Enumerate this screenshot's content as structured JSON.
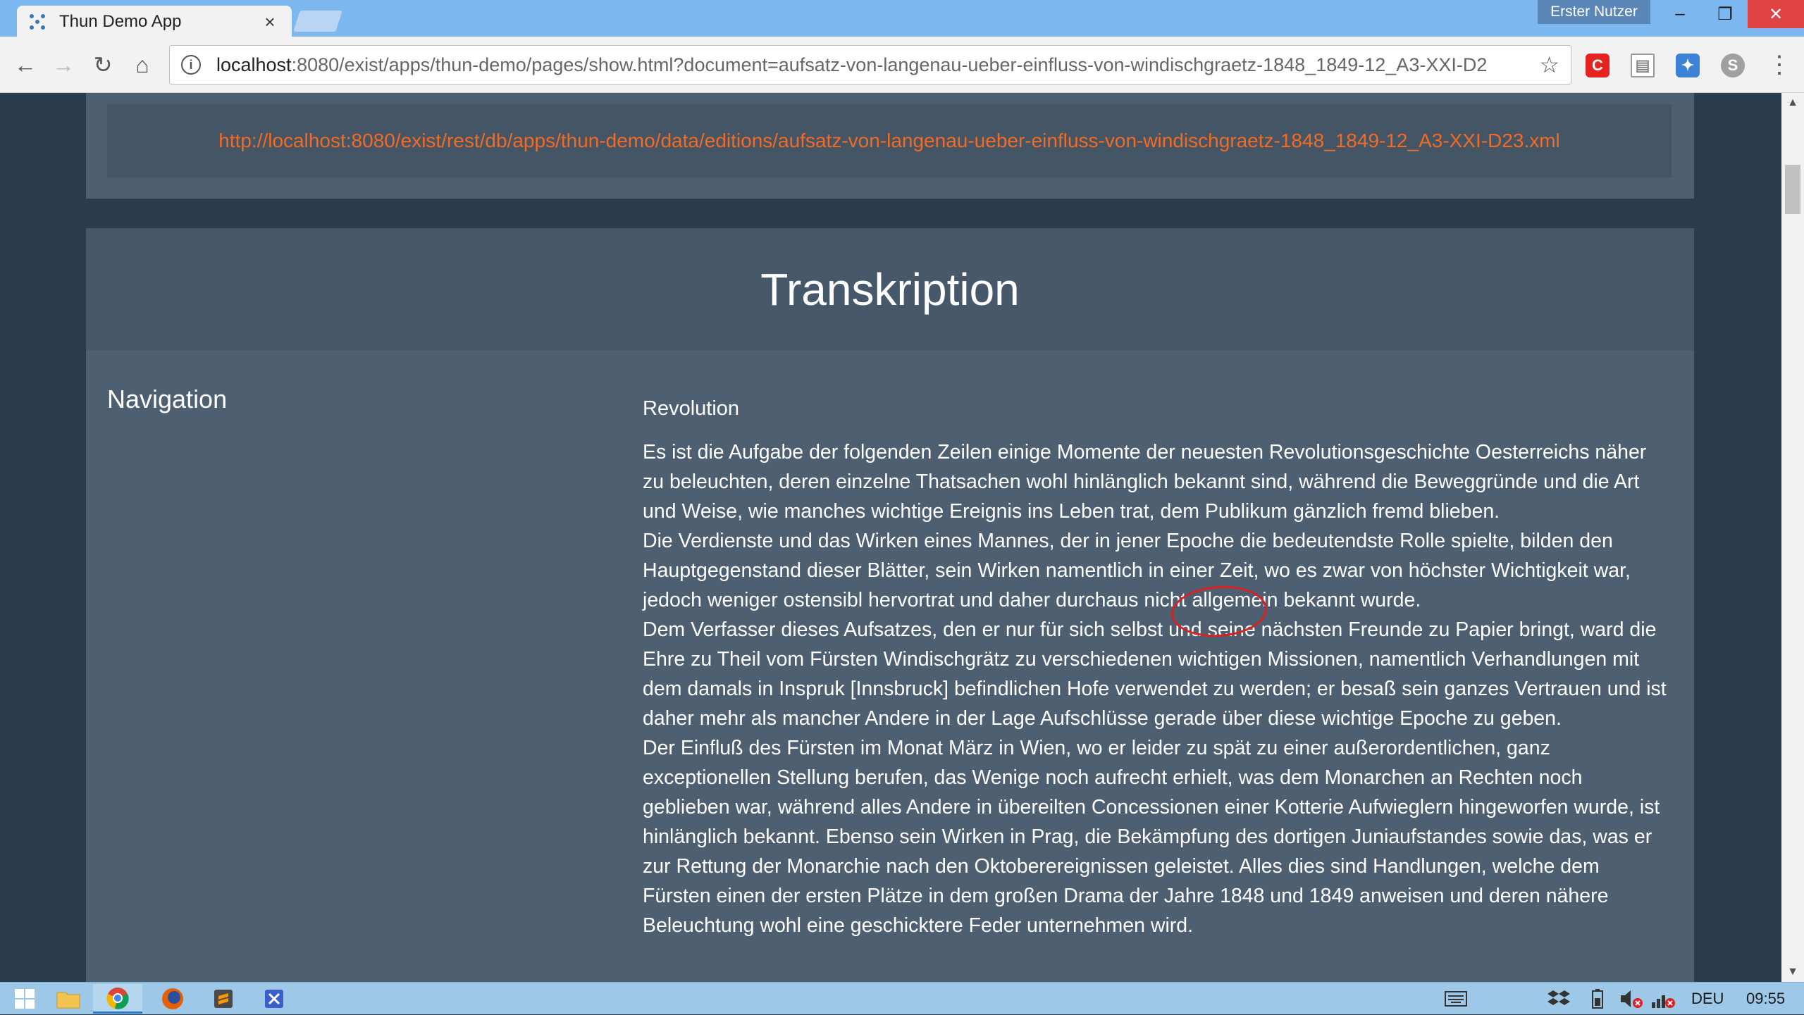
{
  "browser": {
    "tab_title": "Thun Demo App",
    "tab_close": "×",
    "user_badge": "Erster Nutzer",
    "window_controls": {
      "minimize": "–",
      "restore": "❐",
      "close": "✕"
    },
    "nav": {
      "back": "←",
      "forward": "→",
      "reload": "↻",
      "home": "⌂"
    },
    "url_host": "localhost",
    "url_rest": ":8080/exist/apps/thun-demo/pages/show.html?document=aufsatz-von-langenau-ueber-einfluss-von-windischgraetz-1848_1849-12_A3-XXI-D2",
    "star": "☆",
    "menu": "⋮",
    "extensions": [
      {
        "name": "c-extension-icon",
        "glyph": "C",
        "color": "#e52421"
      },
      {
        "name": "document-extension-icon",
        "glyph": "▤",
        "color": "#9a9a9a"
      },
      {
        "name": "puzzle-extension-icon",
        "glyph": "✦",
        "color": "#3c83d6"
      },
      {
        "name": "skype-extension-icon",
        "glyph": "S",
        "color": "#a0a0a0"
      }
    ]
  },
  "page": {
    "xml_link": "http://localhost:8080/exist/rest/db/apps/thun-demo/data/editions/aufsatz-von-langenau-ueber-einfluss-von-windischgraetz-1848_1849-12_A3-XXI-D23.xml",
    "title": "Transkription",
    "navigation_heading": "Navigation",
    "section_heading": "Revolution",
    "paragraphs": [
      "Es ist die Aufgabe der folgenden Zeilen einige Momente der neuesten Revolutionsgeschichte Oesterreichs näher zu beleuchten, deren einzelne Thatsachen wohl hinlänglich bekannt sind, während die Beweggründe und die Art und Weise, wie manches wichtige Ereignis ins Leben trat, dem Publikum gänzlich fremd blieben.",
      "Die Verdienste und das Wirken eines Mannes, der in jener Epoche die bedeutendste Rolle spielte, bilden den Hauptgegenstand dieser Blätter, sein Wirken namentlich in einer Zeit, wo es zwar von höchster Wichtigkeit war, jedoch weniger ostensibl hervortrat und daher durchaus nicht allgemein bekannt wurde.",
      "Dem Verfasser dieses Aufsatzes, den er nur für sich selbst und seine nächsten Freunde zu Papier bringt, ward die Ehre zu Theil vom Fürsten Windischgrätz zu verschiedenen wichtigen Missionen, namentlich Verhandlungen mit dem damals in Inspruk [Innsbruck] befindlichen Hofe verwendet zu werden; er besaß sein ganzes Vertrauen und ist daher mehr als mancher Andere in der Lage Aufschlüsse gerade über diese wichtige Epoche zu geben.",
      "Der Einfluß des Fürsten im Monat März in Wien, wo er leider zu spät zu einer außerordentlichen, ganz exceptionellen Stellung berufen, das Wenige noch aufrecht erhielt, was dem Monarchen an Rechten noch geblieben war, während alles Andere in übereilten Concessionen einer Kotterie Aufwieglern hingeworfen wurde, ist hinlänglich bekannt. Ebenso sein Wirken in Prag, die Bekämpfung des dortigen Juniaufstandes sowie das, was er zur Rettung der Monarchie nach den Oktoberereignissen geleistet. Alles dies sind Handlungen, welche dem Fürsten einen der ersten Plätze in dem großen Drama der Jahre 1848 und 1849 anweisen und deren nähere Beleuchtung wohl eine geschicktere Feder unternehmen wird."
    ]
  },
  "scrollbar": {
    "up": "▲",
    "down": "▼"
  },
  "taskbar": {
    "language": "DEU",
    "time": "09:55"
  }
}
